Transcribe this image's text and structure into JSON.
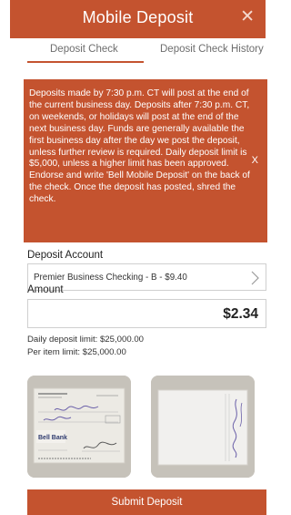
{
  "header": {
    "title": "Mobile Deposit",
    "close_label": "✕"
  },
  "tabs": [
    {
      "label": "Deposit Check",
      "active": true
    },
    {
      "label": "Deposit Check History",
      "active": false
    }
  ],
  "notice": {
    "text": "Deposits made by 7:30 p.m. CT will post at the end of the current business day. Deposits after 7:30 p.m. CT, on weekends, or holidays will post at the end of the next business day. Funds are generally available the first business day after the day we post the deposit, unless further review is required. Daily deposit limit is $5,000, unless a higher limit has been approved. Endorse and write 'Bell Mobile Deposit' on the back of the check. Once the deposit has posted, shred the check.",
    "dismiss_label": "X"
  },
  "deposit_account": {
    "label": "Deposit Account",
    "value": "Premier Business Checking - B - $9.40"
  },
  "amount": {
    "label": "Amount",
    "value": "$2.34"
  },
  "limits": {
    "daily": "Daily deposit limit: $25,000.00",
    "per_item": "Per item limit: $25,000.00"
  },
  "check_images": {
    "front": {
      "bank_name": "Bell Bank"
    }
  },
  "submit_label": "Submit Deposit",
  "colors": {
    "brand": "#c4532f",
    "header_text": "#ffffff"
  }
}
